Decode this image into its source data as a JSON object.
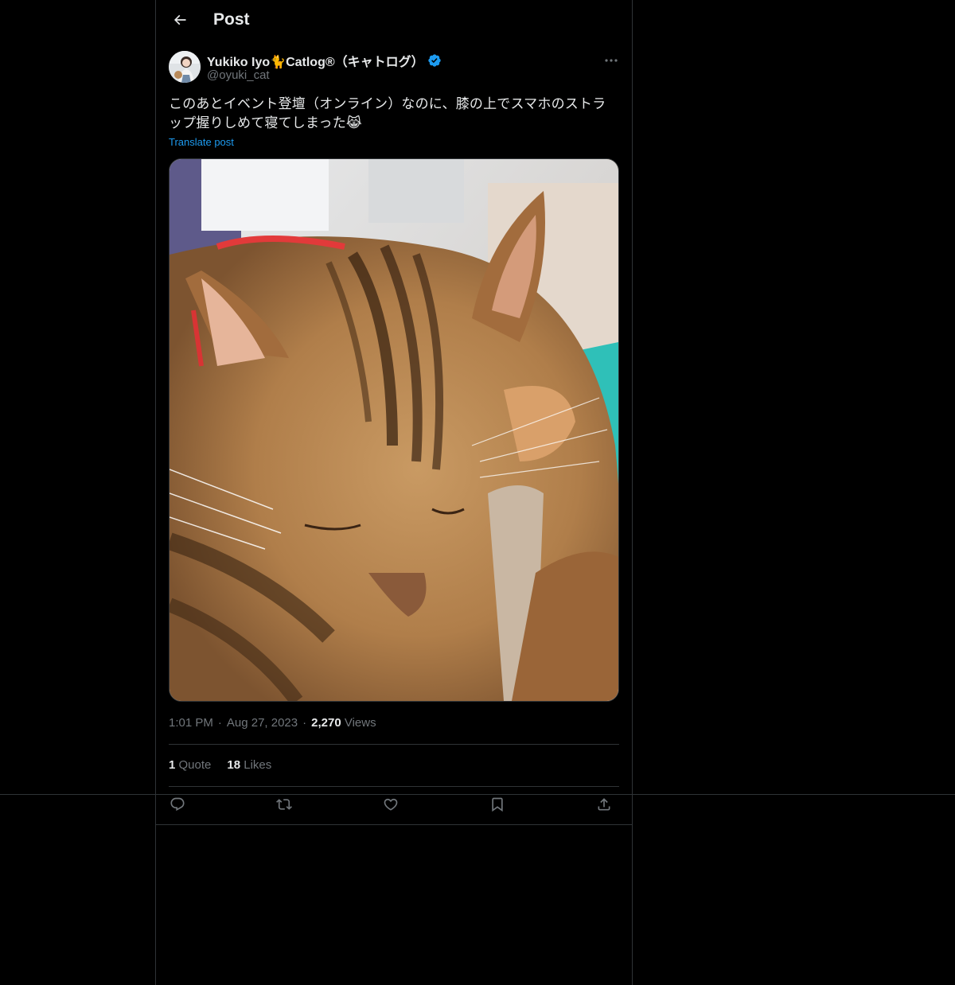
{
  "header": {
    "title": "Post",
    "back_icon": "arrow-left-icon"
  },
  "author": {
    "display_name": "Yukiko Iyo🐈Catlog®（キャトログ）",
    "handle": "@oyuki_cat",
    "verified_icon": "verified-badge-icon",
    "more_icon": "more-horizontal-icon"
  },
  "post": {
    "text": "このあとイベント登壇（オンライン）なのに、膝の上でスマホのストラップ握りしめて寝てしまった😹",
    "translate_label": "Translate post",
    "media_subject": "sleeping-bengal-cat-photo"
  },
  "meta": {
    "time": "1:01 PM",
    "date": "Aug 27, 2023",
    "views_count": "2,270",
    "views_label": "Views"
  },
  "stats": {
    "quotes_count": "1",
    "quotes_label": "Quote",
    "likes_count": "18",
    "likes_label": "Likes"
  },
  "actions": {
    "reply_icon": "reply-icon",
    "repost_icon": "repost-icon",
    "like_icon": "heart-icon",
    "bookmark_icon": "bookmark-icon",
    "share_icon": "share-icon"
  },
  "colors": {
    "background": "#000000",
    "text_primary": "#e7e9ea",
    "text_secondary": "#71767b",
    "accent": "#1d9bf0",
    "border": "#2f3336"
  }
}
